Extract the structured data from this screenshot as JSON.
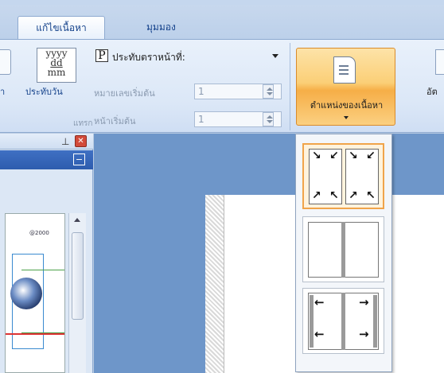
{
  "ribbon": {
    "tabs": [
      {
        "label": "แก้ไขเนื้อหา",
        "active": true
      },
      {
        "label": "มุมมอง",
        "active": false
      }
    ],
    "left_cut_label": "า",
    "date_icon_text": [
      "yyyy",
      "dd",
      "mm"
    ],
    "stamp_date_label": "ประทับวัน",
    "page_stamp_label": "ประทับตราหน้าที่:",
    "page_stamp_icon": "P",
    "start_number_label": "หมายเลขเริ่มต้น",
    "start_number_value": "1",
    "start_page_label": "หน้าเริ่มต้น",
    "start_page_value": "1",
    "group_label": "แทรก",
    "position_button_label": "ตำแหน่งของเนื้อหา",
    "right_cut_label": "อัต"
  },
  "accent": {
    "orange": "#f4a24a",
    "ribbon_blue": "#15428b",
    "workspace": "#6e96c9"
  },
  "gallery": {
    "options": [
      {
        "name": "corner-arrows-inward",
        "selected": true
      },
      {
        "name": "center-gutter",
        "selected": false
      },
      {
        "name": "side-arrows-outward",
        "selected": false
      }
    ]
  },
  "pane": {
    "pin_icon": "pin-icon",
    "close_icon": "close-icon",
    "thumb_text": "@2000"
  }
}
